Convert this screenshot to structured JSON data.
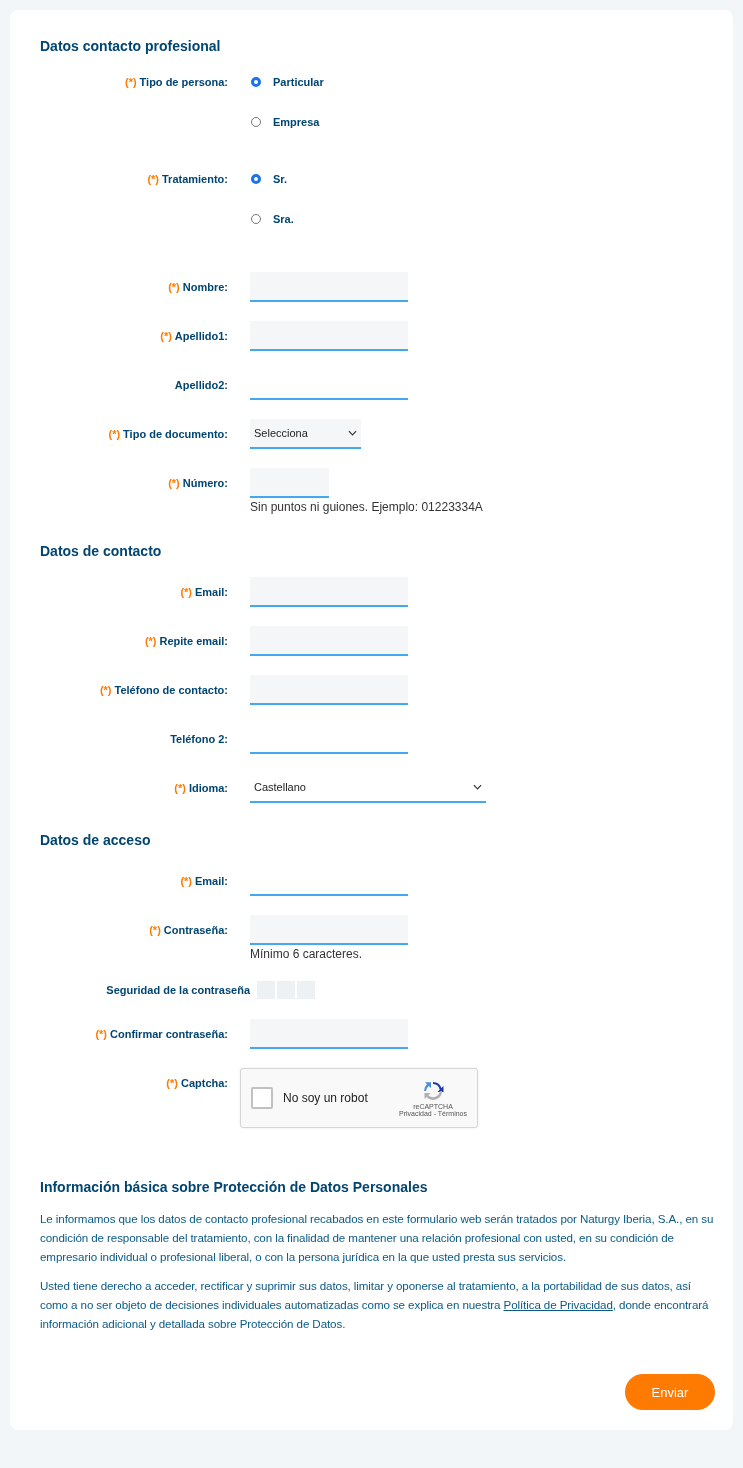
{
  "sections": [
    {
      "title": "Datos contacto profesional",
      "fields": [
        {
          "kind": "radio",
          "mark": "(*)",
          "label": "Tipo de persona:",
          "options": [
            {
              "label": "Particular",
              "selected": true
            },
            {
              "label": "Empresa",
              "selected": false
            }
          ]
        },
        {
          "kind": "radio",
          "mark": "(*)",
          "label": "Tratamiento:",
          "options": [
            {
              "label": "Sr.",
              "selected": true
            },
            {
              "label": "Sra.",
              "selected": false
            }
          ]
        },
        {
          "kind": "text",
          "mark": "(*)",
          "label": "Nombre:"
        },
        {
          "kind": "text",
          "mark": "(*)",
          "label": "Apellido1:"
        },
        {
          "kind": "text",
          "label": "Apellido2:"
        },
        {
          "kind": "select",
          "mark": "(*)",
          "label": "Tipo de documento:",
          "value": "Selecciona"
        },
        {
          "kind": "text",
          "mark": "(*)",
          "label": "Número:",
          "hint": "Sin puntos ni guiones. Ejemplo: 01223334A"
        }
      ]
    },
    {
      "title": "Datos de contacto",
      "fields": [
        {
          "kind": "text",
          "mark": "(*)",
          "label": "Email:"
        },
        {
          "kind": "text",
          "mark": "(*)",
          "label": "Repite email:"
        },
        {
          "kind": "text",
          "mark": "(*)",
          "label": "Teléfono de contacto:"
        },
        {
          "kind": "text",
          "label": "Teléfono 2:"
        },
        {
          "kind": "select",
          "mark": "(*)",
          "label": "Idioma:",
          "value": "Castellano"
        }
      ]
    },
    {
      "title": "Datos de acceso",
      "fields": [
        {
          "kind": "text",
          "mark": "(*)",
          "label": "Email:"
        },
        {
          "kind": "text",
          "mark": "(*)",
          "label": "Contraseña:",
          "hint": "Mínimo 6 caracteres."
        },
        {
          "kind": "strength",
          "label": "Seguridad de la contraseña"
        },
        {
          "kind": "text",
          "mark": "(*)",
          "label": "Confirmar contraseña:"
        },
        {
          "kind": "captcha",
          "mark": "(*)",
          "label": "Captcha:",
          "checkbox_label": "No soy un robot",
          "checked": false,
          "brand": "reCAPTCHA",
          "links": "Privacidad - Términos"
        }
      ]
    }
  ],
  "privacy": {
    "title": "Información básica sobre Protección de Datos Personales",
    "paragraphs": [
      {
        "text": "Le informamos que los datos de contacto profesional recabados en este formulario web serán tratados por Naturgy Iberia, S.A., en su condición de responsable del tratamiento, con la finalidad de mantener una relación profesional con usted, en su condición de empresario individual o profesional liberal, o con la persona jurídica en la que usted presta sus servicios."
      },
      {
        "text": "Usted tiene derecho a acceder, rectificar y suprimir sus datos, limitar y oponerse al tratamiento, a la portabilidad de sus datos, así como a no ser objeto de decisiones individuales automatizadas como se explica en nuestra",
        "link": "Política de Privacidad",
        "after": ", donde encontrará información adicional y detallada sobre Protección de Datos."
      }
    ]
  },
  "submit": "Enviar"
}
